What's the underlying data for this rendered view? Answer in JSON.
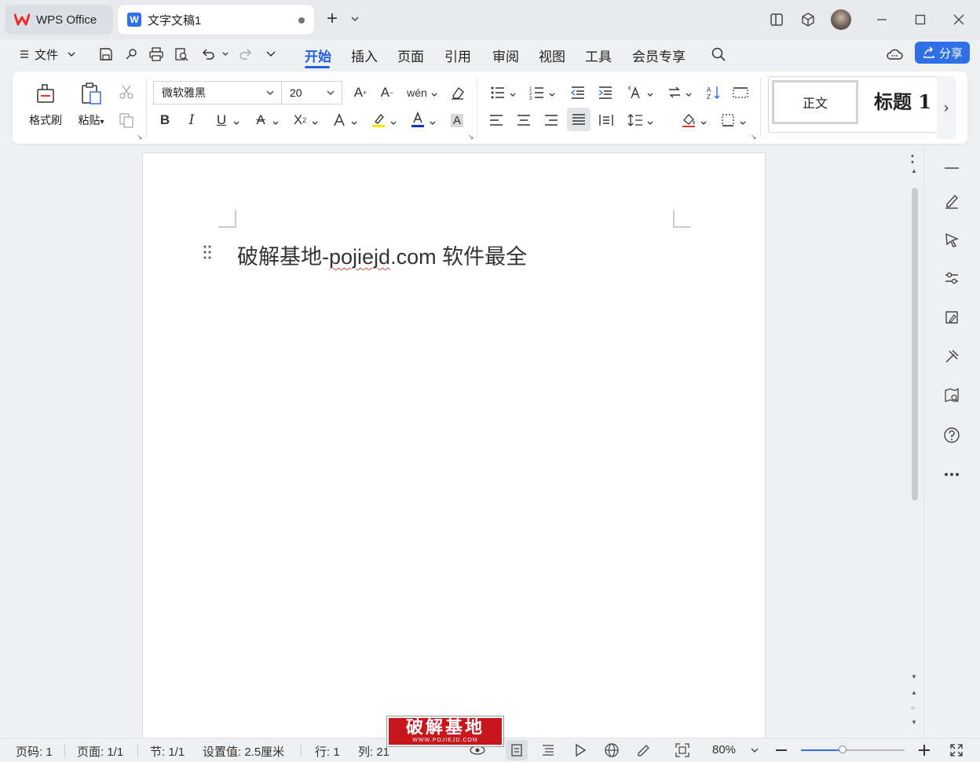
{
  "titlebar": {
    "home_tab_label": "WPS Office",
    "doc_tab_label": "文字文稿1"
  },
  "menubar": {
    "file_label": "文件",
    "tabs": [
      "开始",
      "插入",
      "页面",
      "引用",
      "审阅",
      "视图",
      "工具",
      "会员专享"
    ],
    "active_tab": "开始",
    "share_label": "分享"
  },
  "ribbon": {
    "format_painter_label": "格式刷",
    "paste_label": "粘贴",
    "font_name": "微软雅黑",
    "font_size": "20",
    "style_normal": "正文",
    "style_heading": "标题 1"
  },
  "document": {
    "text_before": "破解基地-",
    "text_misspelled": "pojiejd",
    "text_after": ".com 软件最全"
  },
  "statusbar": {
    "page_number": "页码: 1",
    "pages": "页面: 1/1",
    "section": "节: 1/1",
    "setting": "设置值: 2.5厘米",
    "line": "行: 1",
    "column": "列: 21",
    "zoom": "80%",
    "zoom_level": 0.8
  },
  "watermark": {
    "main": "破解基地",
    "sub": "WWW.POJIEJD.COM"
  },
  "colors": {
    "accent": "#2460e6",
    "share_button": "#2f6fe8",
    "wps_red": "#e8322e",
    "watermark_red": "#c8161d"
  }
}
